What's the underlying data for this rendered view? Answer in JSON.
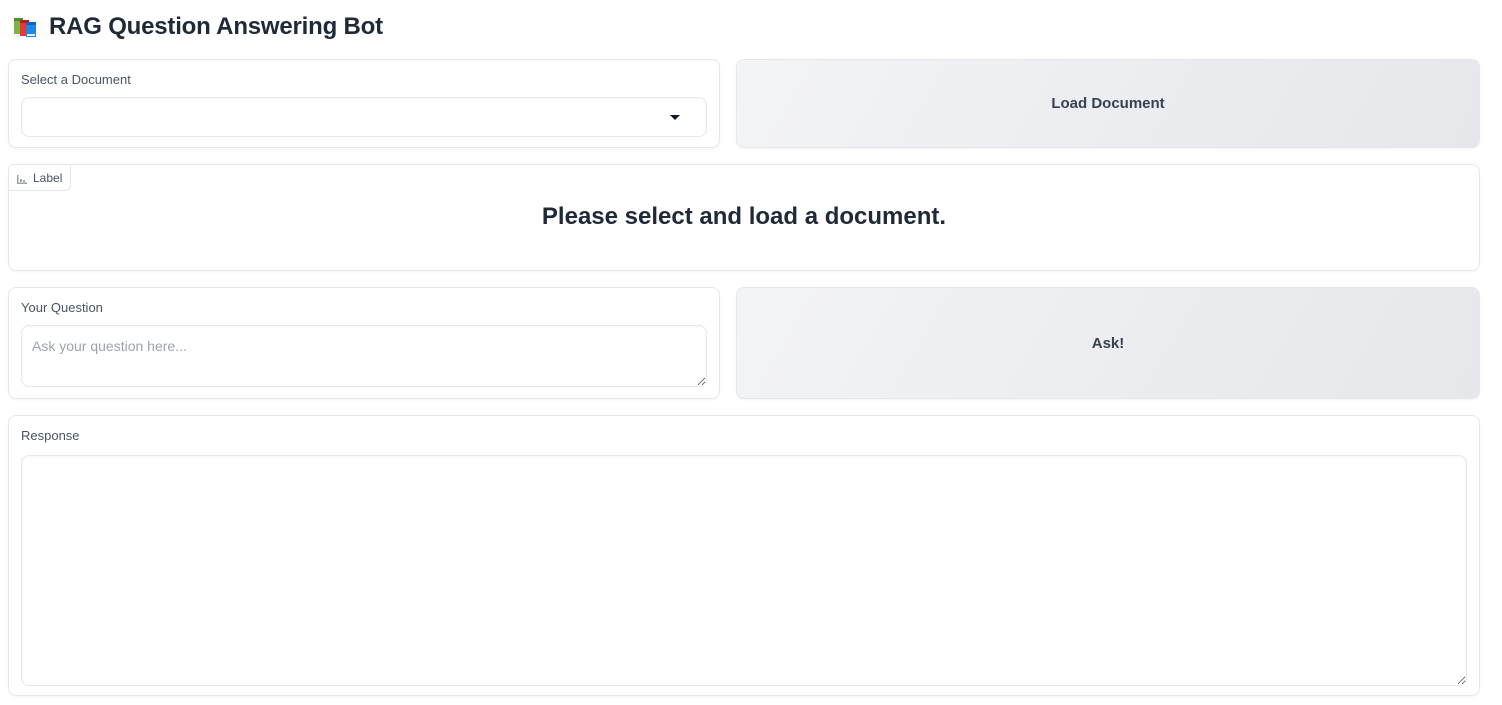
{
  "header": {
    "icon": "books-icon",
    "title": "RAG Question Answering Bot"
  },
  "document_select": {
    "label": "Select a Document",
    "value": ""
  },
  "load_button": {
    "label": "Load Document"
  },
  "status_label": {
    "tag": "Label",
    "text": "Please select and load a document."
  },
  "question": {
    "label": "Your Question",
    "placeholder": "Ask your question here...",
    "value": ""
  },
  "ask_button": {
    "label": "Ask!"
  },
  "response": {
    "label": "Response",
    "value": ""
  },
  "colors": {
    "button_bg_start": "#f3f4f6",
    "button_bg_end": "#e5e7eb",
    "border": "#e5e7eb",
    "text": "#1f2937"
  }
}
